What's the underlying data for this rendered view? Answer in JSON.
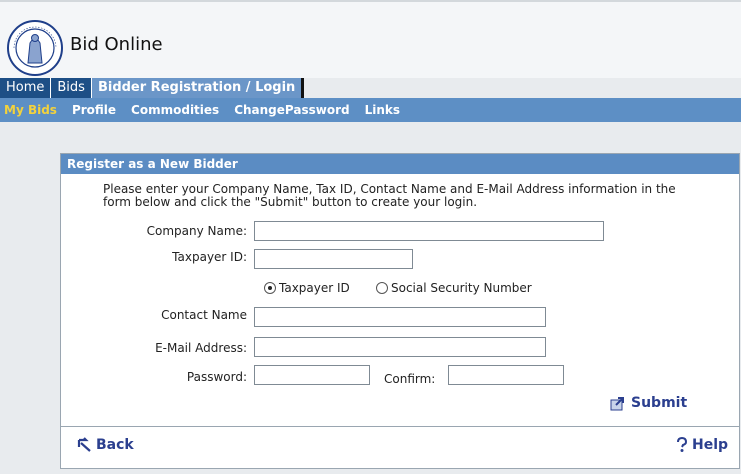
{
  "site": {
    "title": "Bid Online",
    "seal_text": "CITY OF COLUMBIA S.C."
  },
  "tabs": [
    {
      "label": "Home"
    },
    {
      "label": "Bids"
    },
    {
      "label": "Bidder Registration / Login"
    }
  ],
  "subnav": [
    {
      "label": "My Bids"
    },
    {
      "label": "Profile"
    },
    {
      "label": "Commodities"
    },
    {
      "label": "ChangePassword"
    },
    {
      "label": "Links"
    }
  ],
  "form": {
    "header": "Register as a New Bidder",
    "intro": "Please enter your Company Name, Tax ID, Contact Name and E-Mail Address information in the form below and click the \"Submit\" button to create your login.",
    "company_label": "Company Name:",
    "company_value": "",
    "taxpayer_label": "Taxpayer ID:",
    "taxpayer_value": "",
    "radio_taxpayer": "Taxpayer ID",
    "radio_ssn": "Social Security Number",
    "radio_selected": "taxpayer",
    "contact_label": "Contact Name",
    "contact_value": "",
    "email_label": "E-Mail Address:",
    "email_value": "",
    "password_label": "Password:",
    "confirm_label": "Confirm:",
    "submit_label": "Submit"
  },
  "footer": {
    "back_label": "Back",
    "help_label": "Help"
  },
  "colors": {
    "nav_dark": "#1d4f86",
    "nav_light": "#5d8fc5",
    "active_yellow": "#f3d23c"
  }
}
